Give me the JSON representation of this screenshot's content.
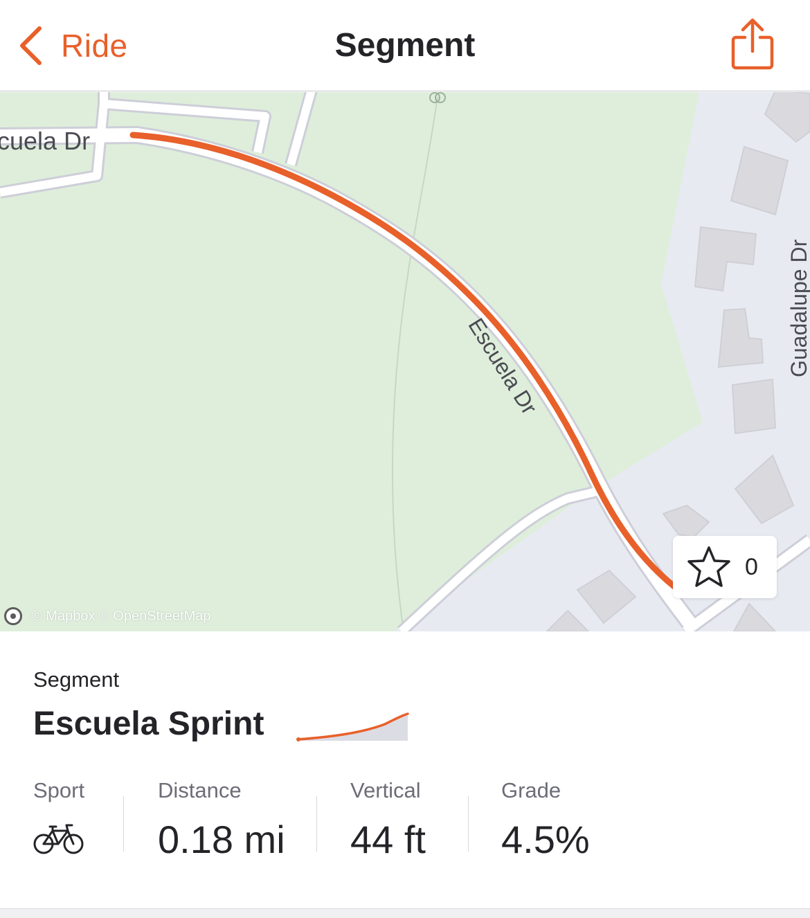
{
  "header": {
    "back_label": "Ride",
    "title": "Segment",
    "back_icon": "chevron-left-icon",
    "share_icon": "share-icon"
  },
  "map": {
    "labels": {
      "road_west": "cuela Dr",
      "road_mid": "Escuela Dr",
      "road_east": "Guadalupe Dr"
    },
    "attribution": "© Mapbox © OpenStreetMap",
    "star_count": "0",
    "colors": {
      "route": "#e8602a",
      "park": "#deeedb",
      "land": "#e8eaf2",
      "road": "#ffffff",
      "building": "#d9d9de"
    }
  },
  "segment": {
    "kicker": "Segment",
    "name": "Escuela Sprint"
  },
  "stats": [
    {
      "label": "Sport",
      "icon": "bike-icon"
    },
    {
      "label": "Distance",
      "value": "0.18 mi"
    },
    {
      "label": "Vertical",
      "value": "44 ft"
    },
    {
      "label": "Grade",
      "value": "4.5%"
    }
  ],
  "accent_color": "#e8602a"
}
